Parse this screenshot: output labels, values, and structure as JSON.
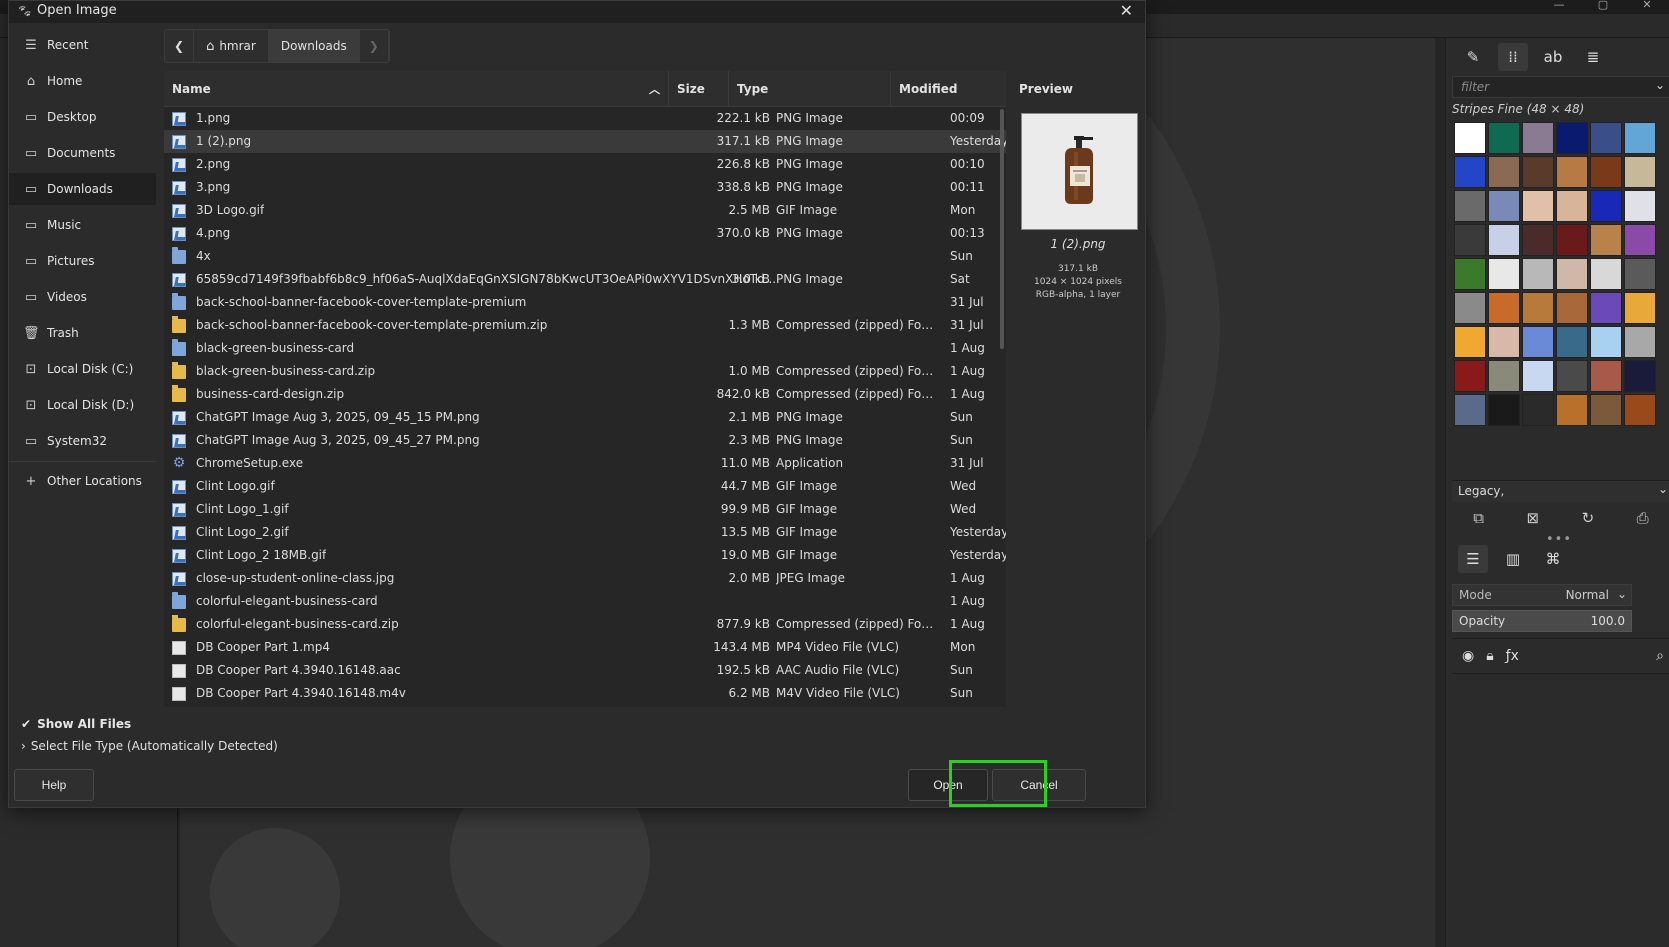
{
  "dialog": {
    "title": "Open Image",
    "close_glyph": "✕"
  },
  "sidebar": {
    "items": [
      {
        "label": "Recent",
        "icon": "history-icon"
      },
      {
        "label": "Home",
        "icon": "home-icon"
      },
      {
        "label": "Desktop",
        "icon": "folder-icon"
      },
      {
        "label": "Documents",
        "icon": "folder-icon"
      },
      {
        "label": "Downloads",
        "icon": "folder-icon",
        "active": true
      },
      {
        "label": "Music",
        "icon": "folder-icon"
      },
      {
        "label": "Pictures",
        "icon": "folder-icon"
      },
      {
        "label": "Videos",
        "icon": "folder-icon"
      },
      {
        "label": "Trash",
        "icon": "trash-icon"
      },
      {
        "label": "Local Disk (C:)",
        "icon": "disk-icon"
      },
      {
        "label": "Local Disk (D:)",
        "icon": "disk-icon"
      },
      {
        "label": "System32",
        "icon": "folder-icon"
      },
      {
        "label": "Other Locations",
        "icon": "plus-icon"
      }
    ]
  },
  "pathbar": {
    "crumbs": [
      "hmrar",
      "Downloads"
    ]
  },
  "filelist": {
    "columns": {
      "name": "Name",
      "size": "Size",
      "type": "Type",
      "modified": "Modified"
    },
    "rows": [
      {
        "icon": "image",
        "name": "1.png",
        "size": "222.1 kB",
        "type": "PNG Image",
        "modified": "00:09"
      },
      {
        "icon": "image",
        "name": "1 (2).png",
        "size": "317.1 kB",
        "type": "PNG Image",
        "modified": "Yesterday",
        "selected": true
      },
      {
        "icon": "image",
        "name": "2.png",
        "size": "226.8 kB",
        "type": "PNG Image",
        "modified": "00:10"
      },
      {
        "icon": "image",
        "name": "3.png",
        "size": "338.8 kB",
        "type": "PNG Image",
        "modified": "00:11"
      },
      {
        "icon": "image",
        "name": "3D Logo.gif",
        "size": "2.5 MB",
        "type": "GIF Image",
        "modified": "Mon"
      },
      {
        "icon": "image",
        "name": "4.png",
        "size": "370.0 kB",
        "type": "PNG Image",
        "modified": "00:13"
      },
      {
        "icon": "folder",
        "name": "4x",
        "size": "",
        "type": "",
        "modified": "Sun"
      },
      {
        "icon": "image",
        "name": "65859cd7149f39fbabf6b8c9_hf06aS-AuqlXdaEqGnXSIGN78bKwcUT3OeAPi0wXYV1DSvnXHoTd...",
        "size": "3.0 kB",
        "type": "PNG Image",
        "modified": "Sat"
      },
      {
        "icon": "folder",
        "name": "back-school-banner-facebook-cover-template-premium",
        "size": "",
        "type": "",
        "modified": "31 Jul"
      },
      {
        "icon": "zip",
        "name": "back-school-banner-facebook-cover-template-premium.zip",
        "size": "1.3 MB",
        "type": "Compressed (zipped) Folder",
        "modified": "31 Jul"
      },
      {
        "icon": "folder",
        "name": "black-green-business-card",
        "size": "",
        "type": "",
        "modified": "1 Aug"
      },
      {
        "icon": "zip",
        "name": "black-green-business-card.zip",
        "size": "1.0 MB",
        "type": "Compressed (zipped) Folder",
        "modified": "1 Aug"
      },
      {
        "icon": "zip",
        "name": "business-card-design.zip",
        "size": "842.0 kB",
        "type": "Compressed (zipped) Folder",
        "modified": "1 Aug"
      },
      {
        "icon": "image",
        "name": "ChatGPT Image Aug 3, 2025, 09_45_15 PM.png",
        "size": "2.1 MB",
        "type": "PNG Image",
        "modified": "Sun"
      },
      {
        "icon": "image",
        "name": "ChatGPT Image Aug 3, 2025, 09_45_27 PM.png",
        "size": "2.3 MB",
        "type": "PNG Image",
        "modified": "Sun"
      },
      {
        "icon": "exe",
        "name": "ChromeSetup.exe",
        "size": "11.0 MB",
        "type": "Application",
        "modified": "31 Jul"
      },
      {
        "icon": "image",
        "name": "Clint Logo.gif",
        "size": "44.7 MB",
        "type": "GIF Image",
        "modified": "Wed"
      },
      {
        "icon": "image",
        "name": "Clint Logo_1.gif",
        "size": "99.9 MB",
        "type": "GIF Image",
        "modified": "Wed"
      },
      {
        "icon": "image",
        "name": "Clint Logo_2.gif",
        "size": "13.5 MB",
        "type": "GIF Image",
        "modified": "Yesterday"
      },
      {
        "icon": "image",
        "name": "Clint Logo_2 18MB.gif",
        "size": "19.0 MB",
        "type": "GIF Image",
        "modified": "Yesterday"
      },
      {
        "icon": "image",
        "name": "close-up-student-online-class.jpg",
        "size": "2.0 MB",
        "type": "JPEG Image",
        "modified": "1 Aug"
      },
      {
        "icon": "folder",
        "name": "colorful-elegant-business-card",
        "size": "",
        "type": "",
        "modified": "1 Aug"
      },
      {
        "icon": "zip",
        "name": "colorful-elegant-business-card.zip",
        "size": "877.9 kB",
        "type": "Compressed (zipped) Folder",
        "modified": "1 Aug"
      },
      {
        "icon": "doc",
        "name": "DB Cooper Part 1.mp4",
        "size": "143.4 MB",
        "type": "MP4 Video File (VLC)",
        "modified": "Mon"
      },
      {
        "icon": "doc",
        "name": "DB Cooper Part 4.3940.16148.aac",
        "size": "192.5 kB",
        "type": "AAC Audio File (VLC)",
        "modified": "Sun"
      },
      {
        "icon": "doc",
        "name": "DB Cooper Part 4.3940.16148.m4v",
        "size": "6.2 MB",
        "type": "M4V Video File (VLC)",
        "modified": "Sun"
      }
    ]
  },
  "preview": {
    "label": "Preview",
    "name": "1 (2).png",
    "size": "317.1 kB",
    "dimensions": "1024 × 1024 pixels",
    "mode": "RGB-alpha, 1 layer"
  },
  "options": {
    "show_all_files": "Show All Files",
    "select_file_type": "Select File Type (Automatically Detected)"
  },
  "buttons": {
    "help": "Help",
    "open": "Open",
    "cancel": "Cancel"
  },
  "colors": {
    "highlight": "#2bd11f",
    "dialog_bg": "#2b2b2b",
    "list_bg": "#262626",
    "selected_row": "#3a3a3a"
  },
  "dock": {
    "filter_placeholder": "filter",
    "pattern_title": "Stripes Fine (48 × 48)",
    "preset": "Legacy,",
    "mode_label": "Mode",
    "mode_value": "Normal",
    "opacity_label": "Opacity",
    "opacity_value": "100.0"
  }
}
